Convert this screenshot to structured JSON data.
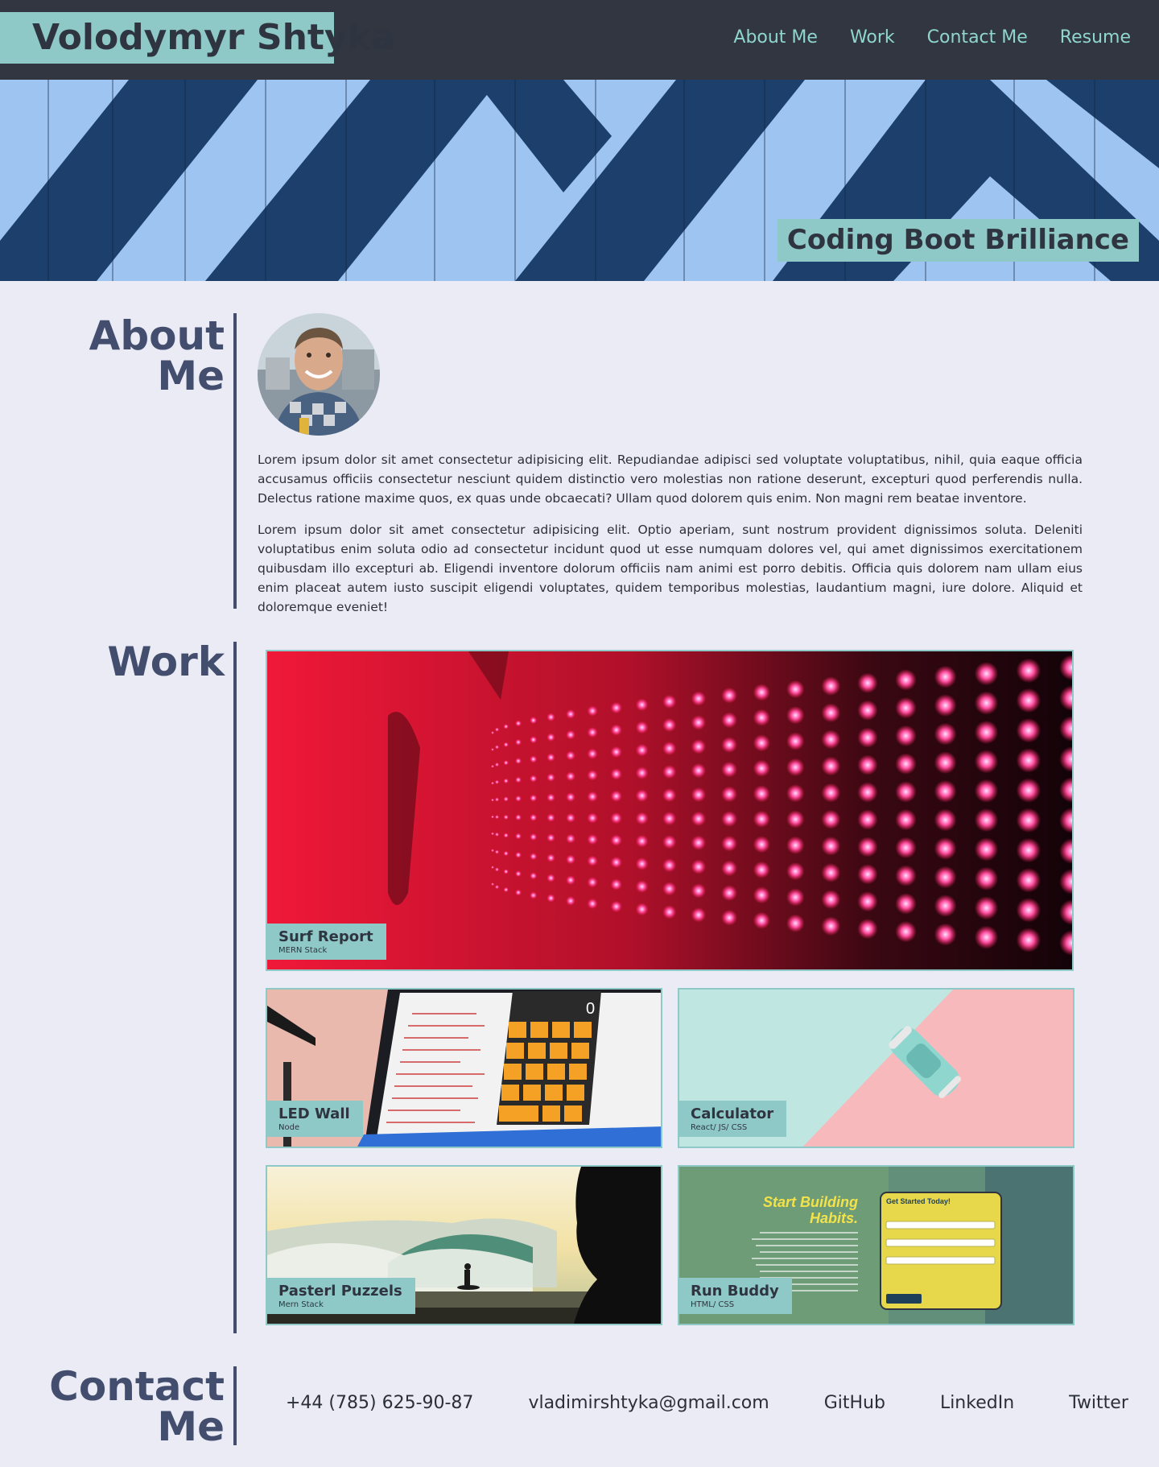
{
  "header": {
    "brand": "Volodymyr Shtyka",
    "nav": [
      "About Me",
      "Work",
      "Contact Me",
      "Resume"
    ]
  },
  "hero": {
    "tagline": "Coding Boot Brilliance"
  },
  "about": {
    "title_line1": "About",
    "title_line2": "Me",
    "paragraphs": [
      "Lorem ipsum dolor sit amet consectetur adipisicing elit. Repudiandae adipisci sed voluptate voluptatibus, nihil, quia eaque officia accusamus officiis consectetur nesciunt quidem distinctio vero molestias non ratione deserunt, excepturi quod perferendis nulla. Delectus ratione maxime quos, ex quas unde obcaecati? Ullam quod dolorem quis enim. Non magni rem beatae inventore.",
      "Lorem ipsum dolor sit amet consectetur adipisicing elit. Optio aperiam, sunt nostrum provident dignissimos soluta. Deleniti voluptatibus enim soluta odio ad consectetur incidunt quod ut esse numquam dolores vel, qui amet dignissimos exercitationem quibusdam illo excepturi ab. Eligendi inventore dolorum officiis nam animi est porro debitis. Officia quis dolorem nam ullam eius enim placeat autem iusto suscipit eligendi voluptates, quidem temporibus molestias, laudantium magni, iure dolore. Aliquid et doloremque eveniet!"
    ]
  },
  "work": {
    "title": "Work",
    "projects": [
      {
        "name": "Surf Report",
        "stack": "MERN Stack"
      },
      {
        "name": "LED Wall",
        "stack": "Node"
      },
      {
        "name": "Calculator",
        "stack": "React/ JS/ CSS"
      },
      {
        "name": "Pasterl Puzzels",
        "stack": "Mern Stack"
      },
      {
        "name": "Run Buddy",
        "stack": "HTML/ CSS"
      }
    ],
    "runbuddy_screenshot": {
      "headline_line1": "Start Building",
      "headline_line2": "Habits.",
      "form_title": "Get Started Today!"
    },
    "calculator_display": "0"
  },
  "contact": {
    "title_line1": "Contact",
    "title_line2": "Me",
    "phone": "+44 (785) 625-90-87",
    "email": "vladimirshtyka@gmail.com",
    "links": [
      "GitHub",
      "LinkedIn",
      "Twitter"
    ]
  },
  "colors": {
    "header_bg": "#323640",
    "accent": "#8fc9c7",
    "nav_text": "#8fd6cf",
    "heading": "#434e6e",
    "page_bg": "#ebebf5"
  }
}
